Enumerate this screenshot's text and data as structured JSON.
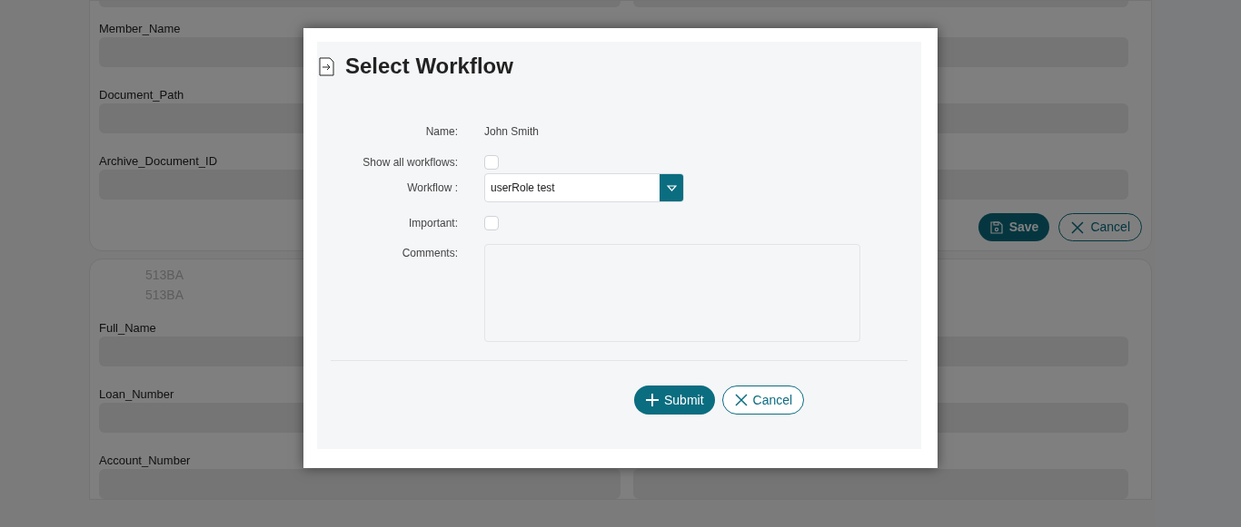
{
  "background": {
    "card_1": {
      "rows": [
        {
          "left_label": "Member_Name"
        },
        {
          "left_label": "Document_Path"
        },
        {
          "left_label": "Archive_Document_ID"
        }
      ],
      "buttons": [
        {
          "kind": "save",
          "label": "Save"
        },
        {
          "kind": "cancel",
          "label": "Cancel"
        }
      ]
    },
    "card_2": {
      "codes": [
        "513BA",
        "513BA"
      ],
      "rows": [
        {
          "left_label": "Full_Name"
        },
        {
          "left_label": "Loan_Number"
        },
        {
          "left_label": "Account_Number"
        }
      ]
    }
  },
  "dialog": {
    "title": "Select Workflow",
    "name": {
      "label": "Name:",
      "value": "John Smith"
    },
    "show_all": {
      "label": "Show all workflows:",
      "checked": false
    },
    "workflow": {
      "label": "Workflow :",
      "value": "userRole test"
    },
    "important": {
      "label": "Important:",
      "checked": false
    },
    "comments": {
      "label": "Comments:"
    },
    "buttons": [
      {
        "kind": "submit",
        "label": "Submit"
      },
      {
        "kind": "cancel",
        "label": "Cancel"
      }
    ]
  }
}
